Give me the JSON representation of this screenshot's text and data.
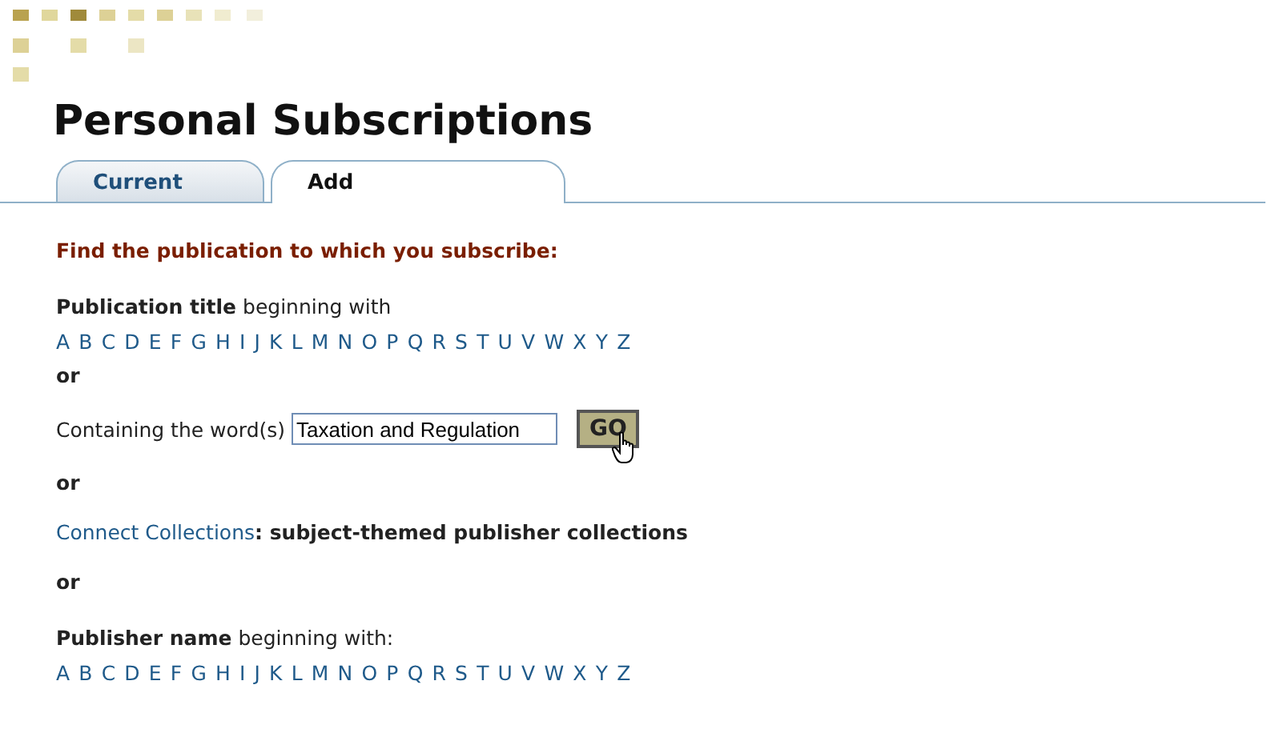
{
  "title": "Personal Subscriptions",
  "tabs": [
    {
      "label": "Current",
      "selected": false
    },
    {
      "label": "Add",
      "selected": true
    }
  ],
  "prompt": "Find the publication to which you subscribe:",
  "title_search": {
    "label_bold": "Publication title",
    "label_rest": "beginning with",
    "letters": [
      "A",
      "B",
      "C",
      "D",
      "E",
      "F",
      "G",
      "H",
      "I",
      "J",
      "K",
      "L",
      "M",
      "N",
      "O",
      "P",
      "Q",
      "R",
      "S",
      "T",
      "U",
      "V",
      "W",
      "X",
      "Y",
      "Z"
    ]
  },
  "or_1": "or",
  "word_search": {
    "label": "Containing the word(s)",
    "value": "Taxation and Regulation",
    "button": "GO"
  },
  "or_2": "or",
  "collections": {
    "link": "Connect Collections",
    "rest": ": subject-themed publisher collections"
  },
  "or_3": "or",
  "publisher_search": {
    "label_bold": "Publisher name",
    "label_rest": "beginning with:",
    "letters": [
      "A",
      "B",
      "C",
      "D",
      "E",
      "F",
      "G",
      "H",
      "I",
      "J",
      "K",
      "L",
      "M",
      "N",
      "O",
      "P",
      "Q",
      "R",
      "S",
      "T",
      "U",
      "V",
      "W",
      "X",
      "Y",
      "Z"
    ]
  }
}
